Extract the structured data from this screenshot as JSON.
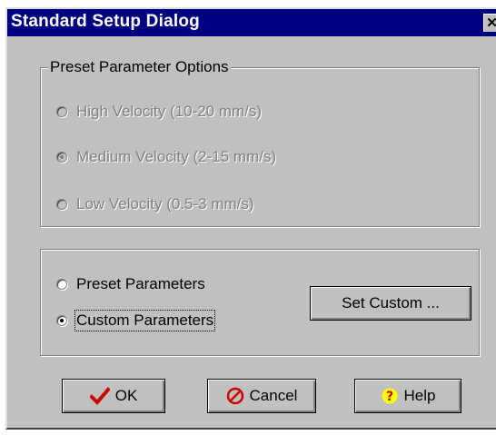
{
  "window": {
    "title": "Standard Setup Dialog",
    "close_label": "✕"
  },
  "preset_group": {
    "legend": "Preset Parameter Options",
    "options": [
      {
        "label": "High Velocity (10-20 mm/s)",
        "checked": false,
        "enabled": false
      },
      {
        "label": "Medium Velocity (2-15 mm/s)",
        "checked": true,
        "enabled": false
      },
      {
        "label": "Low Velocity (0.5-3 mm/s)",
        "checked": false,
        "enabled": false
      }
    ]
  },
  "mode_group": {
    "options": [
      {
        "label": "Preset Parameters",
        "checked": false
      },
      {
        "label": "Custom Parameters",
        "checked": true,
        "focused": true
      }
    ],
    "set_custom_label": "Set Custom ..."
  },
  "buttons": {
    "ok_label": "OK",
    "cancel_label": "Cancel",
    "help_label": "Help"
  },
  "icons": {
    "ok": "checkmark-icon",
    "cancel": "no-entry-icon",
    "help": "question-icon"
  },
  "colors": {
    "titlebar": "#000080",
    "face": "#c0c0c0",
    "ok_check": "#cc0000",
    "cancel_icon": "#d00000",
    "help_circle": "#ffff00",
    "help_mark": "#cc0000"
  }
}
